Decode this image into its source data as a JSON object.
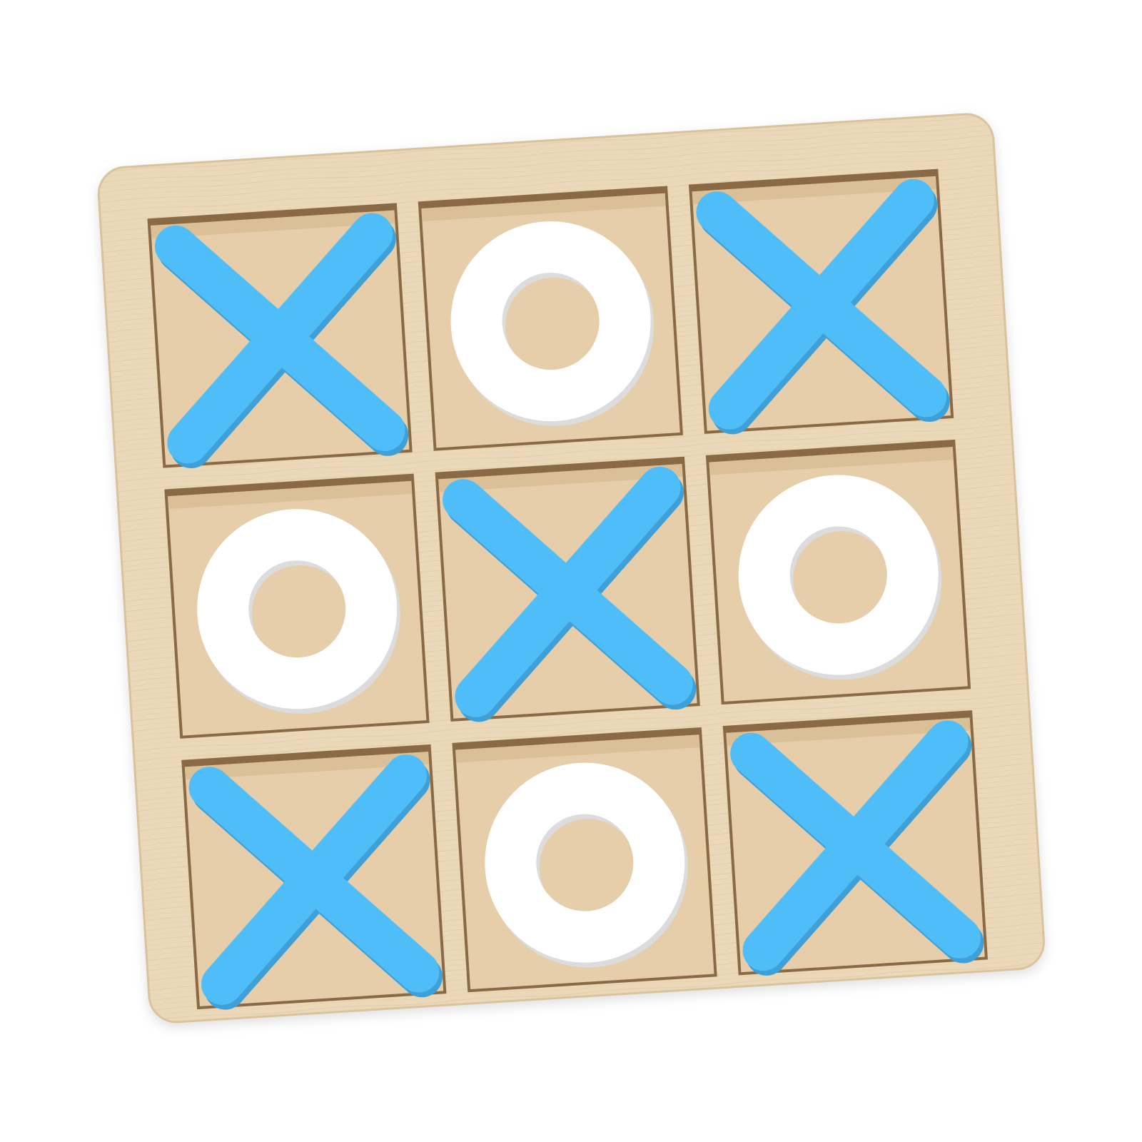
{
  "colors": {
    "background": "#ffffff",
    "board_wood": "#ead8b8",
    "board_edge": "#d9c29c",
    "cell_floor": "#e6ceaa",
    "cell_shadow": "#8a6a44",
    "x_piece": "#4fbdf7",
    "x_piece_side": "#3fa0d8",
    "o_piece": "#ffffff",
    "o_piece_side": "#dcdcdc"
  },
  "game": {
    "board_size": 3,
    "cells": [
      [
        "X",
        "O",
        "X"
      ],
      [
        "O",
        "X",
        "O"
      ],
      [
        "X",
        "O",
        "X"
      ]
    ]
  }
}
